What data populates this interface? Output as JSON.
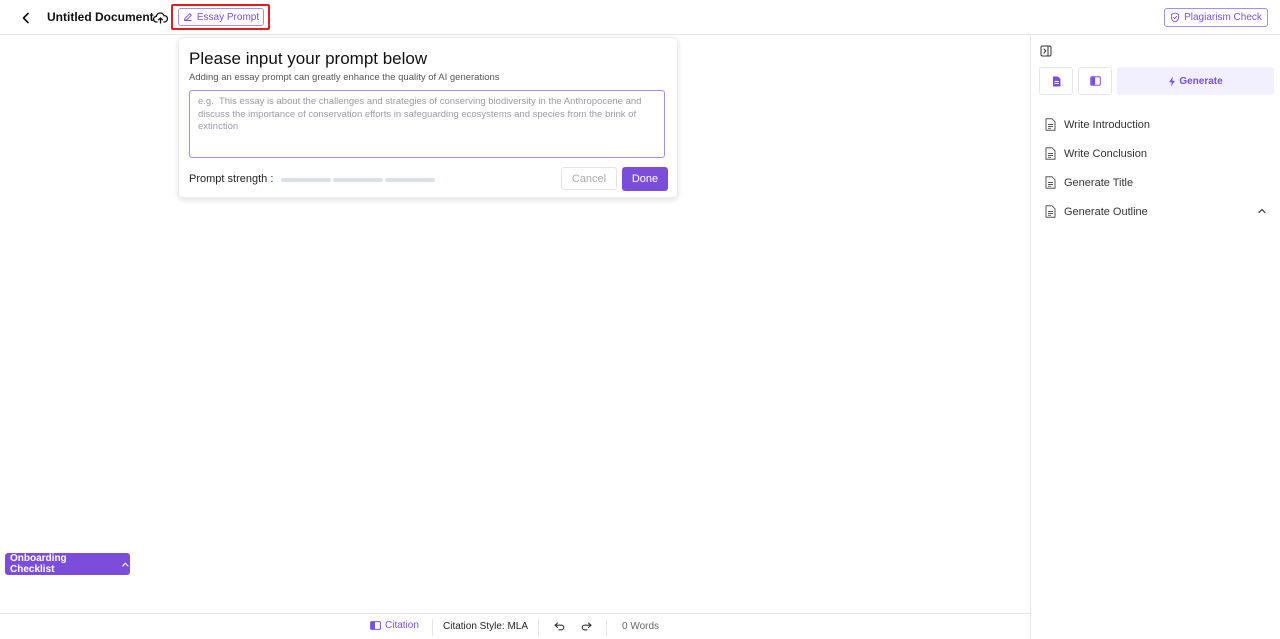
{
  "header": {
    "doc_title": "Untitled Document",
    "essay_prompt_label": "Essay Prompt",
    "plagiarism_label": "Plagiarism Check"
  },
  "prompt_card": {
    "title": "Please input your prompt below",
    "subtitle": "Adding an essay prompt can greatly enhance the quality of AI generations",
    "placeholder": "e.g.  This essay is about the challenges and strategies of conserving biodiversity in the Anthropocene and discuss the importance of conservation efforts in safeguarding ecosystems and species from the brink of extinction",
    "value": "",
    "strength_label": "Prompt strength :",
    "strength_level": 0,
    "cancel_label": "Cancel",
    "done_label": "Done"
  },
  "right_panel": {
    "generate_label": "Generate",
    "actions": [
      {
        "label": "Write Introduction"
      },
      {
        "label": "Write Conclusion"
      },
      {
        "label": "Generate Title"
      },
      {
        "label": "Generate Outline"
      }
    ]
  },
  "footer": {
    "citation_label": "Citation",
    "citation_style_label": "Citation Style: MLA",
    "word_count": "0 Words"
  },
  "onboarding": {
    "label": "Onboarding Checklist"
  },
  "colors": {
    "accent": "#7c4ddb",
    "accent_light": "#f2efff",
    "highlight_border": "#e11d1d"
  }
}
